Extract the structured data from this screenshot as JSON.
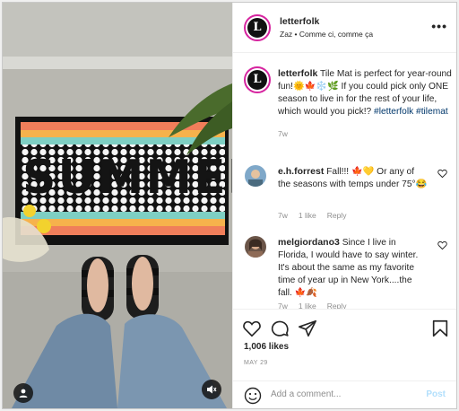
{
  "post": {
    "username": "letterfolk",
    "subtitle": "Zaz • Comme ci, comme ça",
    "avatar_letter": "L",
    "more_label": "•••",
    "mat_text": "SUMMER"
  },
  "caption": {
    "username": "letterfolk",
    "text": "Tile Mat is perfect for year-round fun!🌞🍁❄️🌿 If you could pick only ONE season to live in for the rest of your life, which would you pick!? ",
    "tags": [
      "#letterfolk",
      "#tilemat"
    ],
    "age": "7w"
  },
  "comments": [
    {
      "username": "e.h.forrest",
      "text": "Fall!!! 🍁💛 Or any of the seasons with temps under 75°😂",
      "age": "7w",
      "likes": "1 like",
      "reply": "Reply"
    },
    {
      "username": "melgiordano3",
      "text": "Since I live in Florida, I would have to say winter. It's about the same as my favorite time of year up in New York....the fall. 🍁🍂",
      "age": "7w",
      "likes": "1 like",
      "reply": "Reply"
    }
  ],
  "actions": {
    "likes": "1,006 likes",
    "date": "MAY 29"
  },
  "comment_box": {
    "placeholder": "Add a comment...",
    "post_label": "Post"
  },
  "icons": [
    "heart-icon",
    "comment-icon",
    "share-icon",
    "bookmark-icon",
    "user-tag-icon",
    "volume-icon",
    "emoji-icon",
    "more-icon"
  ],
  "colors": {
    "hashtag": "#00376b",
    "post_disabled": "#b2dffc",
    "meta": "#8e8e8e",
    "avatar_ring": "#d6249f"
  }
}
